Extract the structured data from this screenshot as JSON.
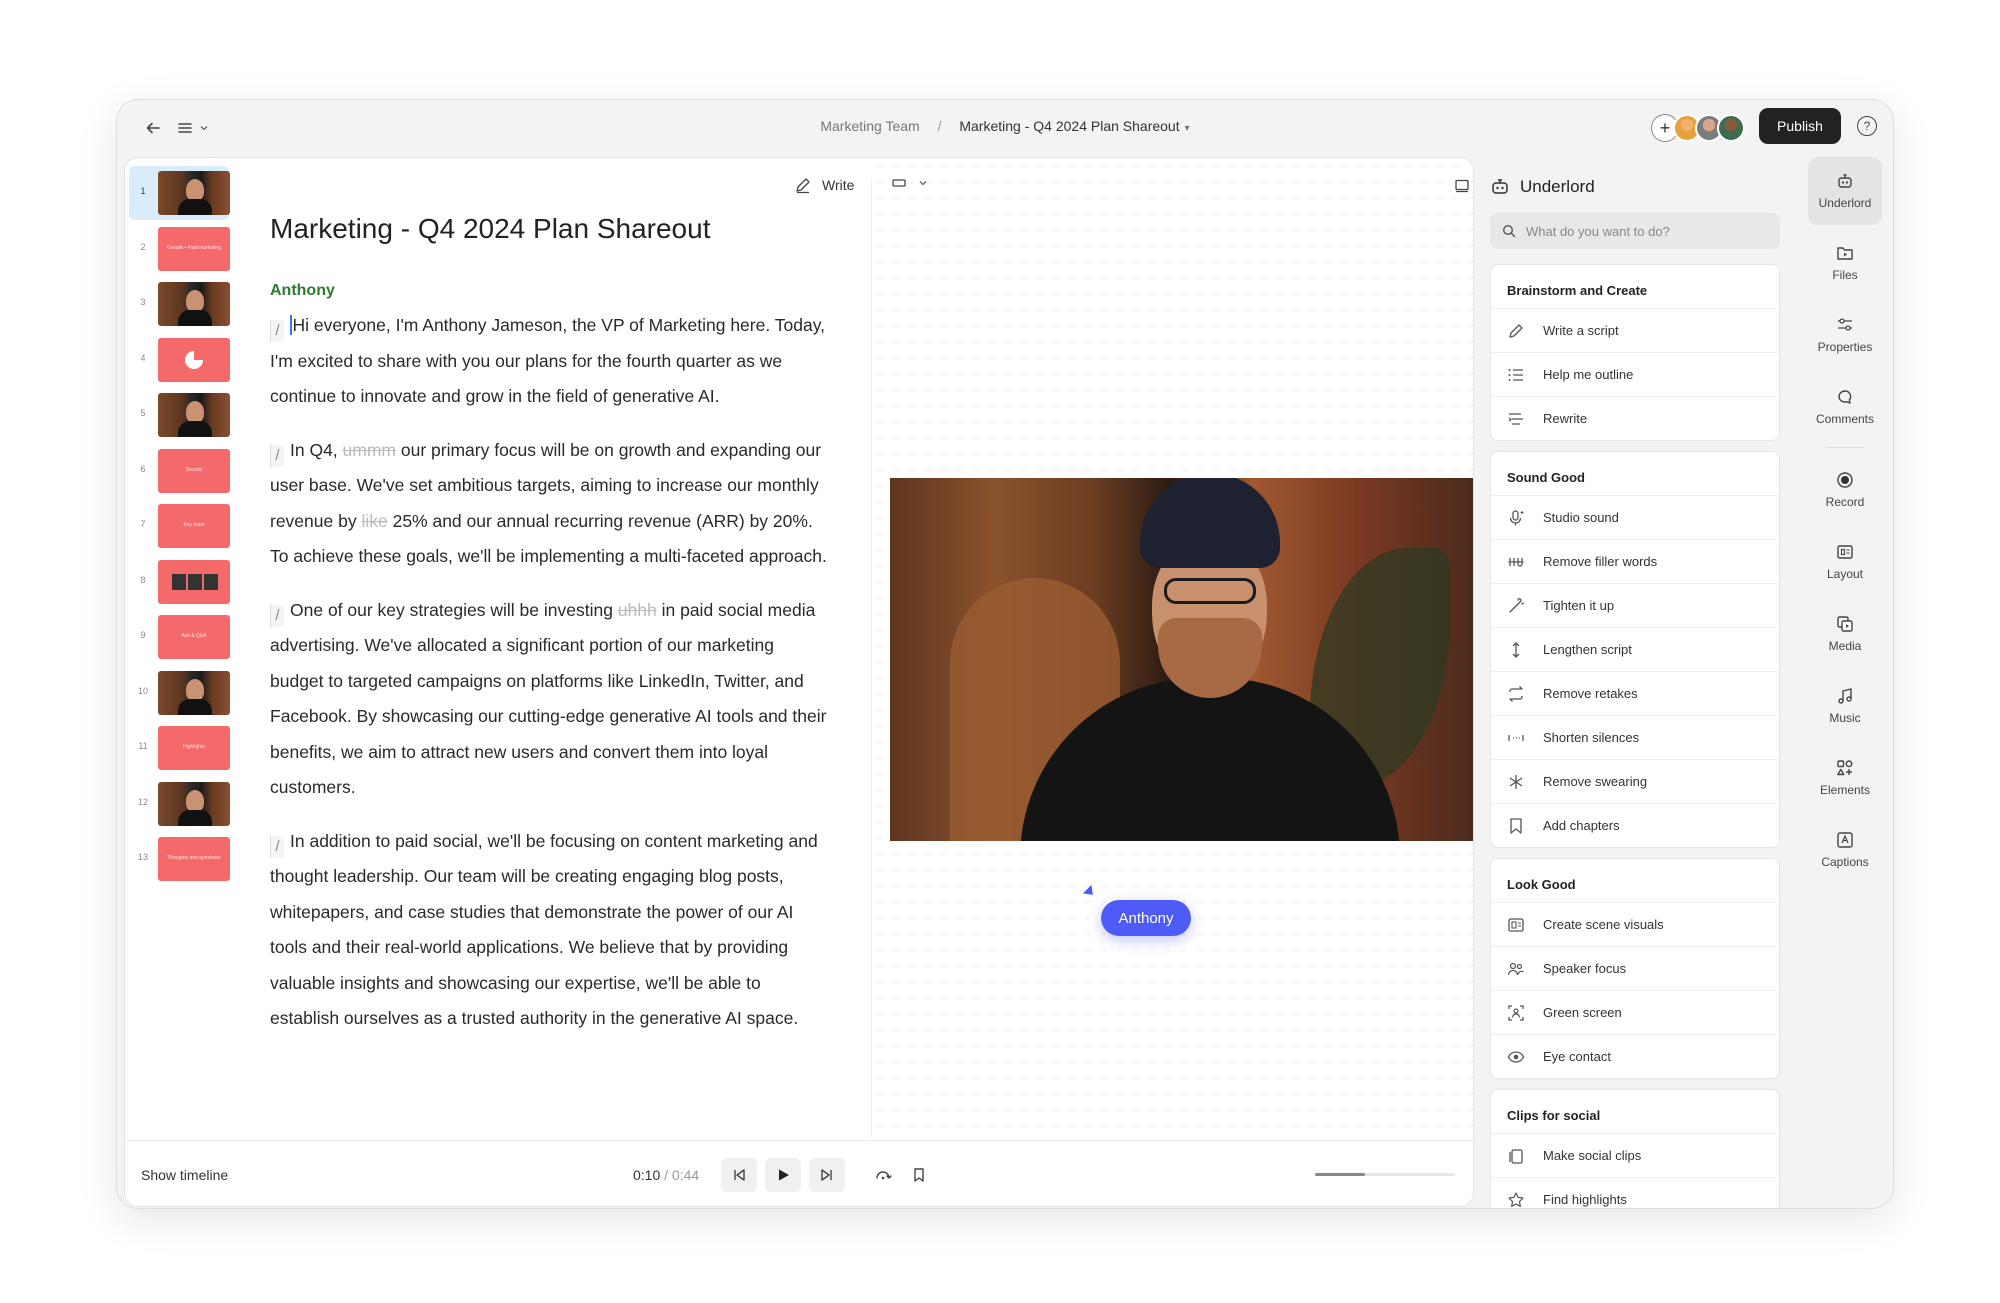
{
  "topbar": {
    "breadcrumb_team": "Marketing Team",
    "breadcrumb_separator": "/",
    "breadcrumb_project": "Marketing - Q4 2024 Plan Shareout",
    "publish_label": "Publish",
    "help_label": "?"
  },
  "slides": [
    {
      "num": "1",
      "kind": "photo"
    },
    {
      "num": "2",
      "kind": "pink",
      "text": "Growth • Paid marketing"
    },
    {
      "num": "3",
      "kind": "photo"
    },
    {
      "num": "4",
      "kind": "pie"
    },
    {
      "num": "5",
      "kind": "photo"
    },
    {
      "num": "6",
      "kind": "pink",
      "text": "Socials"
    },
    {
      "num": "7",
      "kind": "pink",
      "text": "Key team"
    },
    {
      "num": "8",
      "kind": "trio"
    },
    {
      "num": "9",
      "kind": "pink",
      "text": "Ask & Q&A"
    },
    {
      "num": "10",
      "kind": "photo"
    },
    {
      "num": "11",
      "kind": "pink",
      "text": "Highlights"
    },
    {
      "num": "12",
      "kind": "photo"
    },
    {
      "num": "13",
      "kind": "pink",
      "text": "Thoughts and questions"
    }
  ],
  "script": {
    "title": "Marketing - Q4 2024 Plan Shareout",
    "write_label": "Write",
    "speaker": "Anthony",
    "p1": "Hi everyone, I'm Anthony Jameson, the VP of Marketing here. Today, I'm excited to share with you our plans for the fourth quarter as we continue to innovate and grow in the field of generative AI.",
    "p2_a": "In Q4, ",
    "p2_filler": "ummm",
    "p2_b": " our primary focus will be on growth and expanding our user base. We've set ambitious targets, aiming to increase our monthly revenue by ",
    "p2_filler2": "like",
    "p2_c": " 25% and our annual recurring revenue (ARR) by 20%. To achieve these goals, we'll be implementing a multi-faceted approach.",
    "p3_a": "One of our key strategies will be investing ",
    "p3_filler": "uhhh",
    "p3_b": " in paid social media advertising. We've allocated a significant portion of our marketing budget to targeted campaigns on platforms like LinkedIn, Twitter, and Facebook. By showcasing our cutting-edge generative AI tools and their benefits, we aim to attract new users and convert them into loyal customers.",
    "p4": "In addition to paid social, we'll be focusing on content marketing and thought leadership. Our team will be creating engaging blog posts, whitepapers, and case studies that demonstrate the power of our AI tools and their real-world applications. We believe that by providing valuable insights and showcasing our expertise, we'll be able to establish ourselves as a trusted authority in the generative AI space."
  },
  "canvas": {
    "speaker_tag": "Anthony"
  },
  "player": {
    "show_timeline": "Show timeline",
    "current_time": "0:10",
    "time_sep": " / ",
    "total_time": "0:44",
    "zoom_level": 0.36
  },
  "underlord": {
    "title": "Underlord",
    "search_placeholder": "What do you want to do?",
    "sections": [
      {
        "title": "Brainstorm and Create",
        "items": [
          {
            "label": "Write a script",
            "icon": "pen-icon"
          },
          {
            "label": "Help me outline",
            "icon": "list-icon"
          },
          {
            "label": "Rewrite",
            "icon": "rewrite-icon"
          }
        ]
      },
      {
        "title": "Sound Good",
        "items": [
          {
            "label": "Studio sound",
            "icon": "mic-sparkle-icon"
          },
          {
            "label": "Remove filler words",
            "icon": "strikethrough-icon"
          },
          {
            "label": "Tighten it up",
            "icon": "wand-icon"
          },
          {
            "label": "Lengthen script",
            "icon": "vertical-arrows-icon"
          },
          {
            "label": "Remove retakes",
            "icon": "repeat-icon"
          },
          {
            "label": "Shorten silences",
            "icon": "silence-icon"
          },
          {
            "label": "Remove swearing",
            "icon": "asterisk-icon"
          },
          {
            "label": "Add chapters",
            "icon": "bookmark-icon"
          }
        ]
      },
      {
        "title": "Look Good",
        "items": [
          {
            "label": "Create scene visuals",
            "icon": "scene-icon"
          },
          {
            "label": "Speaker focus",
            "icon": "people-icon"
          },
          {
            "label": "Green screen",
            "icon": "person-frame-icon"
          },
          {
            "label": "Eye contact",
            "icon": "eye-icon"
          }
        ]
      },
      {
        "title": "Clips for social",
        "items": [
          {
            "label": "Make social clips",
            "icon": "clips-icon"
          },
          {
            "label": "Find highlights",
            "icon": "star-icon"
          }
        ]
      }
    ]
  },
  "rail": [
    {
      "label": "Underlord",
      "icon": "robot-icon",
      "active": true
    },
    {
      "label": "Files",
      "icon": "folder-icon"
    },
    {
      "label": "Properties",
      "icon": "sliders-icon"
    },
    {
      "label": "Comments",
      "icon": "comment-icon"
    },
    {
      "label": "Record",
      "icon": "record-icon"
    },
    {
      "label": "Layout",
      "icon": "layout-icon"
    },
    {
      "label": "Media",
      "icon": "media-icon"
    },
    {
      "label": "Music",
      "icon": "music-icon"
    },
    {
      "label": "Elements",
      "icon": "elements-icon"
    },
    {
      "label": "Captions",
      "icon": "captions-icon"
    }
  ],
  "colors": {
    "accent": "#4f5bf7",
    "speaker": "#2f7a2f",
    "slide_pink": "#f46a6a",
    "publish_bg": "#222222"
  }
}
